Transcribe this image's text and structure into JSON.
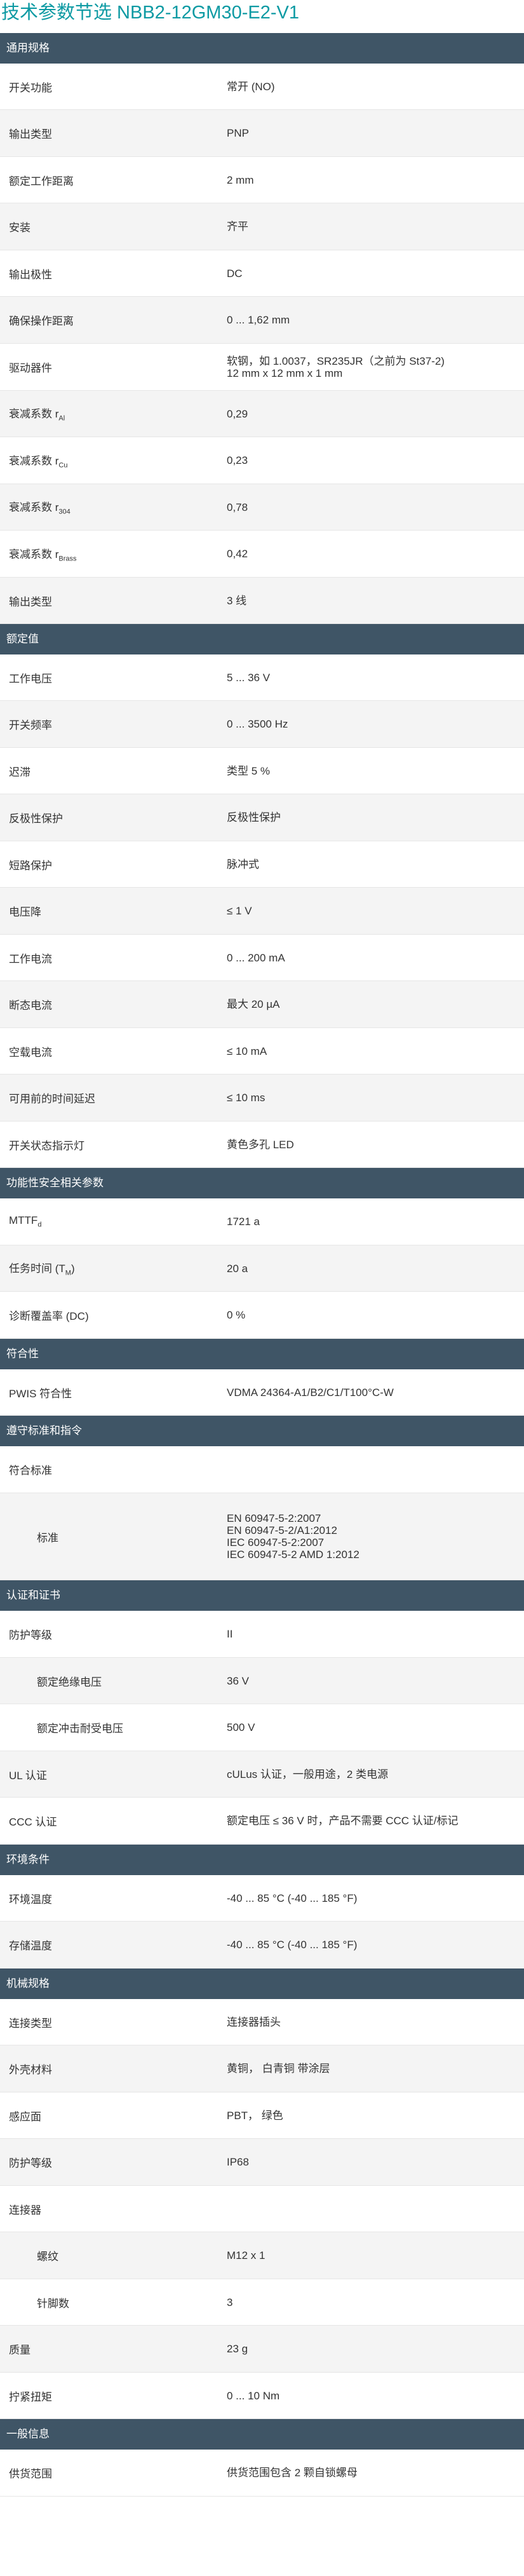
{
  "title": "技术参数节选 NBB2-12GM30-E2-V1",
  "sections": [
    {
      "title": "通用规格",
      "rows": [
        {
          "label": "开关功能",
          "value": [
            "常开 (NO)"
          ],
          "h": 73
        },
        {
          "label": "输出类型",
          "value": [
            "PNP"
          ],
          "h": 74
        },
        {
          "label": "额定工作距离",
          "value": [
            "2 mm"
          ],
          "h": 73
        },
        {
          "label": "安装",
          "value": [
            "齐平"
          ],
          "h": 74
        },
        {
          "label": "输出极性",
          "value": [
            "DC"
          ],
          "h": 73
        },
        {
          "label": "确保操作距离",
          "value": [
            "0 ... 1,62 mm"
          ],
          "h": 74
        },
        {
          "label": "驱动器件",
          "value": [
            "软钢，如 1.0037，SR235JR（之前为 St37-2)",
            "12 mm x 12 mm x 1 mm"
          ],
          "h": 74
        },
        {
          "label": "衰减系数 r",
          "sub": "Al",
          "value": [
            "0,29"
          ],
          "h": 73
        },
        {
          "label": "衰减系数 r",
          "sub": "Cu",
          "value": [
            "0,23"
          ],
          "h": 74
        },
        {
          "label": "衰减系数 r",
          "sub": "304",
          "value": [
            "0,78"
          ],
          "h": 73
        },
        {
          "label": "衰减系数 r",
          "sub": "Brass",
          "value": [
            "0,42"
          ],
          "h": 74
        },
        {
          "label": "输出类型",
          "value": [
            "3 线"
          ],
          "h": 73
        }
      ]
    },
    {
      "title": "额定值",
      "rows": [
        {
          "label": "工作电压",
          "value": [
            "5 ... 36 V"
          ],
          "h": 73
        },
        {
          "label": "开关频率",
          "value": [
            "0 ... 3500 Hz"
          ],
          "h": 74
        },
        {
          "label": "迟滞",
          "value": [
            "类型 5 %"
          ],
          "h": 73
        },
        {
          "label": "反极性保护",
          "value": [
            "反极性保护"
          ],
          "h": 74
        },
        {
          "label": "短路保护",
          "value": [
            "脉冲式"
          ],
          "h": 73
        },
        {
          "label": "电压降",
          "value": [
            "≤ 1 V"
          ],
          "h": 74
        },
        {
          "label": "工作电流",
          "value": [
            "0 ... 200 mA"
          ],
          "h": 73
        },
        {
          "label": "断态电流",
          "value": [
            "最大 20 µA"
          ],
          "h": 74
        },
        {
          "label": "空载电流",
          "value": [
            "≤ 10 mA"
          ],
          "h": 73
        },
        {
          "label": "可用前的时间延迟",
          "value": [
            "≤ 10 ms"
          ],
          "h": 74
        },
        {
          "label": "开关状态指示灯",
          "value": [
            "黄色多孔 LED"
          ],
          "h": 73
        }
      ]
    },
    {
      "title": "功能性安全相关参数",
      "rows": [
        {
          "label": "MTTF",
          "sub": "d",
          "value": [
            "1721 a"
          ],
          "h": 74
        },
        {
          "label": "任务时间 (T",
          "sub": "M",
          "labelEnd": ")",
          "value": [
            "20 a"
          ],
          "h": 73
        },
        {
          "label": "诊断覆盖率 (DC)",
          "value": [
            "0 %"
          ],
          "h": 74
        }
      ]
    },
    {
      "title": "符合性",
      "rows": [
        {
          "label": "PWIS 符合性",
          "value": [
            "VDMA 24364-A1/B2/C1/T100°C-W"
          ],
          "h": 73
        }
      ]
    },
    {
      "title": "遵守标准和指令",
      "rows": [
        {
          "label": "符合标准",
          "value": [],
          "h": 74
        },
        {
          "label": "标准",
          "indent": true,
          "value": [
            "EN 60947-5-2:2007",
            "EN 60947-5-2/A1:2012",
            "IEC 60947-5-2:2007",
            "IEC 60947-5-2 AMD 1:2012"
          ],
          "h": 137
        }
      ]
    },
    {
      "title": "认证和证书",
      "rows": [
        {
          "label": "防护等级",
          "value": [
            "II"
          ],
          "h": 74
        },
        {
          "label": "额定绝缘电压",
          "indent": true,
          "value": [
            "36 V"
          ],
          "h": 73
        },
        {
          "label": "额定冲击耐受电压",
          "indent": true,
          "value": [
            "500 V"
          ],
          "h": 74
        },
        {
          "label": "UL 认证",
          "value": [
            "cULus 认证，一般用途，2 类电源"
          ],
          "h": 73
        },
        {
          "label": "CCC 认证",
          "value": [
            "额定电压 ≤ 36 V 时，产品不需要 CCC 认证/标记"
          ],
          "h": 74
        }
      ]
    },
    {
      "title": "环境条件",
      "rows": [
        {
          "label": "环境温度",
          "value": [
            "-40 ... 85 °C (-40 ... 185 °F)"
          ],
          "h": 73
        },
        {
          "label": "存储温度",
          "value": [
            "-40 ... 85 °C (-40 ... 185 °F)"
          ],
          "h": 74
        }
      ]
    },
    {
      "title": "机械规格",
      "rows": [
        {
          "label": "连接类型",
          "value": [
            "连接器插头"
          ],
          "h": 73
        },
        {
          "label": "外壳材料",
          "value": [
            "黄铜， 白青铜 带涂层"
          ],
          "h": 74
        },
        {
          "label": "感应面",
          "value": [
            "PBT， 绿色"
          ],
          "h": 73
        },
        {
          "label": "防护等级",
          "value": [
            "IP68"
          ],
          "h": 74
        },
        {
          "label": "连接器",
          "value": [],
          "h": 73
        },
        {
          "label": "螺纹",
          "indent": true,
          "value": [
            "M12 x 1"
          ],
          "h": 74
        },
        {
          "label": "针脚数",
          "indent": true,
          "value": [
            "3"
          ],
          "h": 73
        },
        {
          "label": "质量",
          "value": [
            "23 g"
          ],
          "h": 74
        },
        {
          "label": "拧紧扭矩",
          "value": [
            "0 ... 10 Nm"
          ],
          "h": 73
        }
      ]
    },
    {
      "title": "一般信息",
      "rows": [
        {
          "label": "供货范围",
          "value": [
            "供货范围包含 2 颗自锁螺母"
          ],
          "h": 74
        }
      ]
    }
  ]
}
